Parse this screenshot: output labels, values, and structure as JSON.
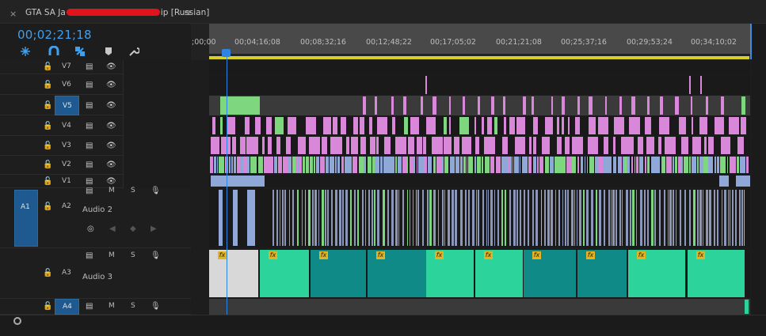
{
  "tab": {
    "close_icon": "×",
    "title_prefix": "GTA SA Ja",
    "title_suffix": "ip [Russian]",
    "menu_icon": "≡"
  },
  "header": {
    "timecode": "00;02;21;18"
  },
  "tools": [
    {
      "name": "snap-nested-icon",
      "glyph": "✲"
    },
    {
      "name": "magnet-icon",
      "glyph": "∩"
    },
    {
      "name": "linked-selection-icon",
      "glyph": "⛓"
    },
    {
      "name": "marker-icon",
      "glyph": "⬟"
    },
    {
      "name": "wrench-icon",
      "glyph": "🔧"
    }
  ],
  "ruler": {
    "labels": [
      ";00;00",
      "00;04;16;08",
      "00;08;32;16",
      "00;12;48;22",
      "00;17;05;02",
      "00;21;21;08",
      "00;25;37;16",
      "00;29;53;24",
      "00;34;10;02"
    ]
  },
  "video_tracks": [
    {
      "id": "V7",
      "source_patch": false
    },
    {
      "id": "V6",
      "source_patch": false
    },
    {
      "id": "V5",
      "source_patch": true
    },
    {
      "id": "V4",
      "source_patch": false
    },
    {
      "id": "V3",
      "source_patch": false
    },
    {
      "id": "V2",
      "source_patch": false
    },
    {
      "id": "V1",
      "source_patch": false
    }
  ],
  "audio_tracks": [
    {
      "id": "A2",
      "name": "Audio 2",
      "source_patch": "A1"
    },
    {
      "id": "A3",
      "name": "Audio 3"
    },
    {
      "id": "A4",
      "name": "",
      "source_patch_highlight": true
    }
  ],
  "audio_controls": {
    "mute": "M",
    "solo": "S"
  },
  "colors": {
    "timecode": "#3fa0f0",
    "playhead": "#2c85e0",
    "pink_clip": "#d987d9",
    "green_clip": "#7ed67e",
    "blue_clip": "#8fa8d8",
    "teal_clip": "#2cd39a",
    "teal_dark": "#0f8a86",
    "work_bar": "#d7d02a",
    "patch": "#1e5a8f"
  }
}
